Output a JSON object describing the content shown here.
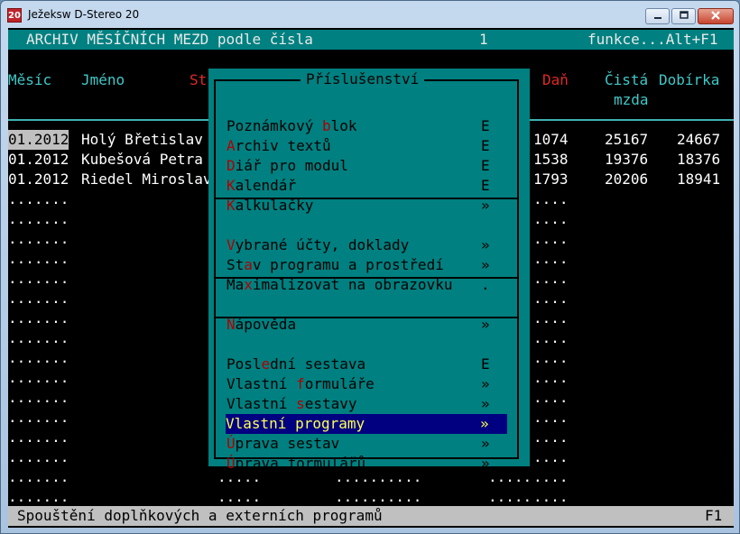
{
  "window": {
    "icon_text": "20",
    "title": "Ježeksw D-Stereo 20"
  },
  "topbar": {
    "left": "ARCHIV MĚSÍČNÍCH MEZD podle čísla",
    "page": "1",
    "right": "funkce...Alt+F1"
  },
  "columns": {
    "month": "Měsíc",
    "name": "Jméno",
    "st": "St",
    "tax": "Daň",
    "net_line1": "Čistá",
    "net_line2": "mzda",
    "payout": "Dobírka"
  },
  "rows": [
    {
      "month": "01.2012",
      "name": "Holý Břetislav",
      "tax": "1074",
      "net": "25167",
      "payout": "24667"
    },
    {
      "month": "01.2012",
      "name": "Kubešová Petra",
      "tax": "1538",
      "net": "19376",
      "payout": "18376"
    },
    {
      "month": "01.2012",
      "name": "Riedel Miroslav",
      "tax": "1793",
      "net": "20206",
      "payout": "18941"
    }
  ],
  "empty_row": {
    "left": ".......",
    "mid": ".....",
    "right": "....",
    "dots_long": "..........",
    "dots_mid": "....."
  },
  "menu": {
    "title": "Příslušenství",
    "groups": [
      [
        {
          "pre": "Poznámkový ",
          "hot": "b",
          "post": "lok",
          "shortcut": "E"
        },
        {
          "pre": "",
          "hot": "A",
          "post": "rchiv textů",
          "shortcut": "E"
        },
        {
          "pre": "",
          "hot": "D",
          "post": "iář pro modul",
          "shortcut": "E"
        },
        {
          "pre": "",
          "hot": "K",
          "post": "alendář",
          "shortcut": "E"
        },
        {
          "pre": "",
          "hot": "K",
          "post": "alkulačky",
          "shortcut": "»"
        }
      ],
      [
        {
          "pre": "",
          "hot": "V",
          "post": "ybrané účty, doklady",
          "shortcut": "»"
        },
        {
          "pre": "St",
          "hot": "a",
          "post": "v programu a prostředí",
          "shortcut": "»"
        },
        {
          "pre": "Ma",
          "hot": "x",
          "post": "imalizovat na obrazovku",
          "shortcut": "."
        }
      ],
      [
        {
          "pre": "",
          "hot": "N",
          "post": "ápověda",
          "shortcut": "»"
        }
      ],
      [
        {
          "pre": "Posl",
          "hot": "e",
          "post": "dní sestava",
          "shortcut": "E"
        },
        {
          "pre": "Vlastní ",
          "hot": "f",
          "post": "ormuláře",
          "shortcut": "»"
        },
        {
          "pre": "Vlastní ",
          "hot": "s",
          "post": "estavy",
          "shortcut": "»"
        },
        {
          "pre": "Vlastní ",
          "hot": "p",
          "post": "rogramy",
          "shortcut": "»"
        },
        {
          "pre": "",
          "hot": "Ú",
          "post": "prava sestav",
          "shortcut": "»"
        },
        {
          "pre": "",
          "hot": "Ú",
          "post": "prava formulářů",
          "shortcut": "»"
        }
      ]
    ],
    "selected": "Vlastní programy"
  },
  "statusbar": {
    "text": "Spouštění doplňkových a externích programů",
    "key": "F1"
  },
  "colors": {
    "menu_bg": "#008080",
    "selection_bg": "#000080",
    "selection_fg": "#ffff54",
    "hotkey": "#b00000",
    "header_cyan": "#40c8c8"
  }
}
